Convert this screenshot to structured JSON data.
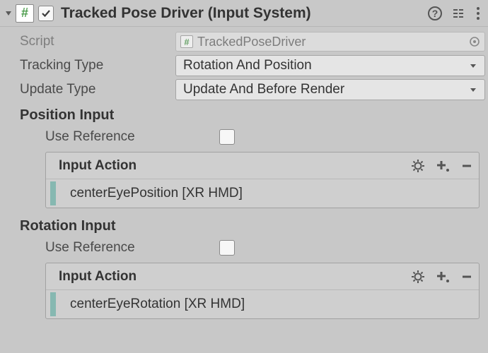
{
  "header": {
    "title": "Tracked Pose Driver (Input System)",
    "enabled": true
  },
  "fields": {
    "script": {
      "label": "Script",
      "value": "TrackedPoseDriver"
    },
    "trackingType": {
      "label": "Tracking Type",
      "value": "Rotation And Position"
    },
    "updateType": {
      "label": "Update Type",
      "value": "Update And Before Render"
    }
  },
  "positionInput": {
    "header": "Position Input",
    "useReferenceLabel": "Use Reference",
    "inputActionLabel": "Input Action",
    "binding": "centerEyePosition [XR HMD]"
  },
  "rotationInput": {
    "header": "Rotation Input",
    "useReferenceLabel": "Use Reference",
    "inputActionLabel": "Input Action",
    "binding": "centerEyeRotation [XR HMD]"
  }
}
